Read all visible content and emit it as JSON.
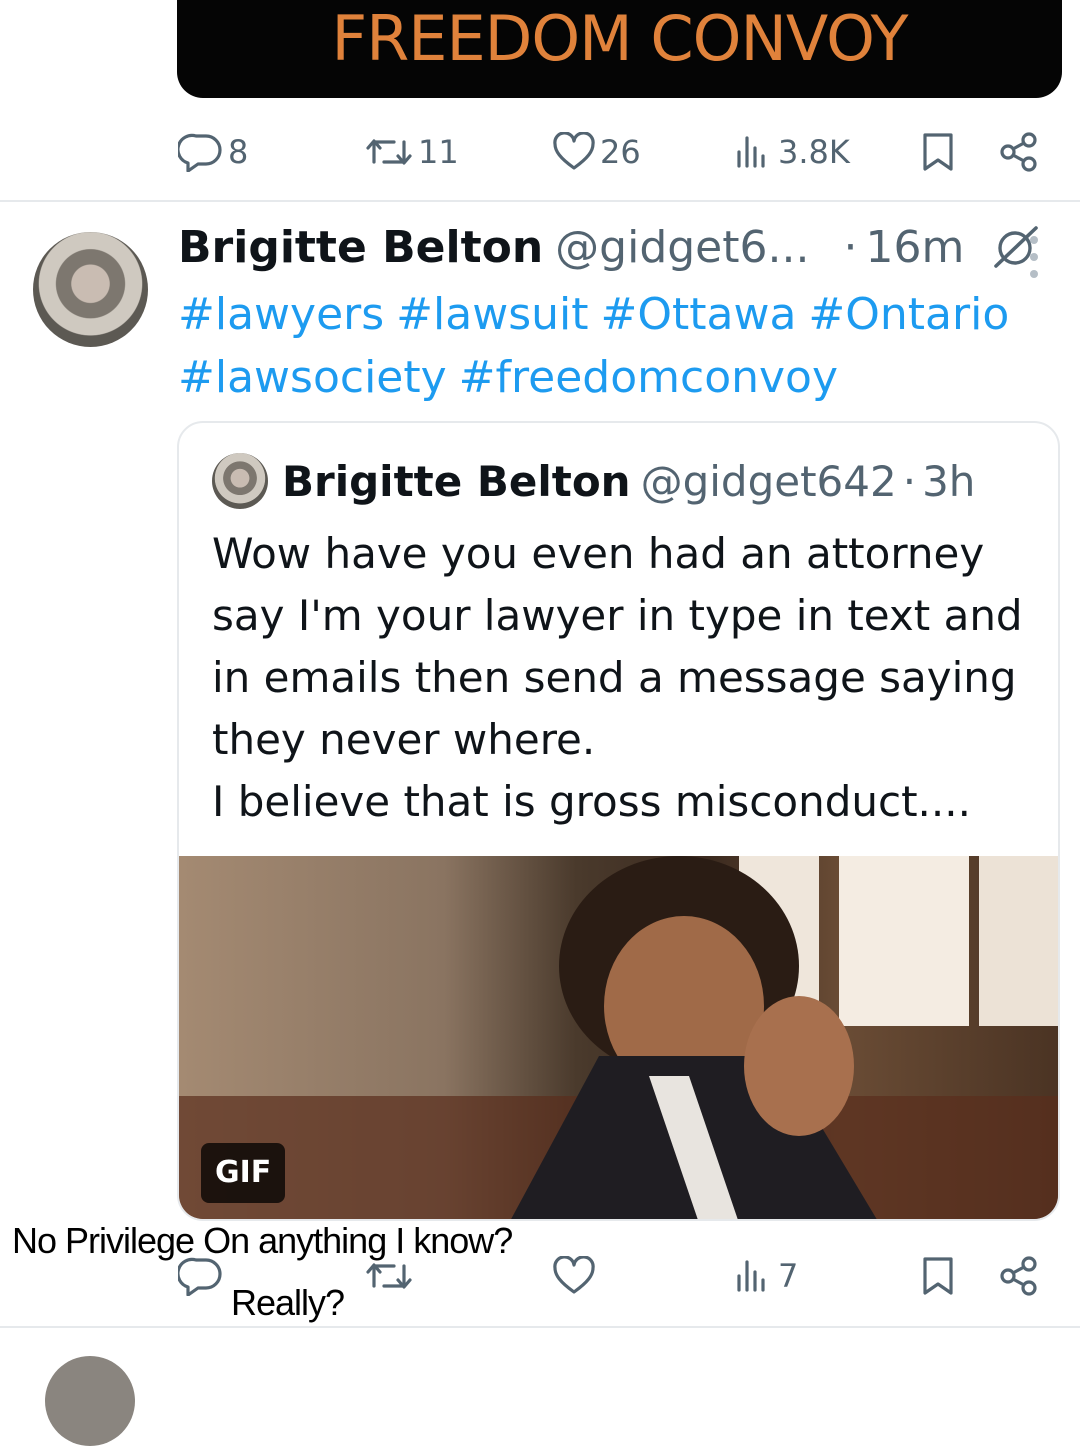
{
  "top_media": {
    "title": "FREEDOM CONVOY"
  },
  "top_actions": {
    "replies": "8",
    "reposts": "11",
    "likes": "26",
    "views": "3.8K"
  },
  "tweet": {
    "author_name": "Brigitte Belton",
    "author_handle": "@gidget6...",
    "time_sep": "·",
    "time": "16m",
    "hashtags": [
      "#lawyers",
      "#lawsuit",
      "#Ottawa",
      "#Ontario",
      "#lawsociety",
      "#freedomconvoy"
    ],
    "quoted": {
      "author_name": "Brigitte Belton",
      "author_handle": "@gidget642",
      "time_sep": "·",
      "time": "3h",
      "text_lines": [
        "Wow have you even had an attorney",
        "say I'm your lawyer in type in text and",
        "in emails then send a message saying",
        "they never where.",
        "I believe that is gross misconduct...."
      ],
      "media_badge": "GIF"
    },
    "actions": {
      "replies": "",
      "reposts": "",
      "likes": "",
      "views": "7"
    }
  },
  "overlay_caption": {
    "line1": "No Privilege On anything I know?",
    "line2": "Really?"
  },
  "colors": {
    "link": "#1d9bf0",
    "secondary_text": "#536471",
    "banner_text": "#e0823b"
  }
}
